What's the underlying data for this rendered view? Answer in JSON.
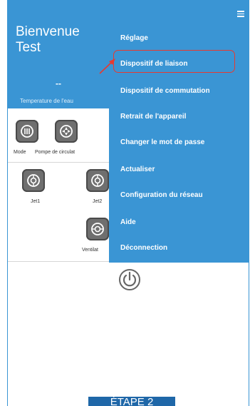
{
  "header": {
    "welcome": "Bienvenue",
    "user": "Test",
    "temperature_value": "--",
    "temperature_label": "Temperature de l'eau"
  },
  "tiles": [
    {
      "label": "Mode",
      "icon": "mode-icon"
    },
    {
      "label": "Pompe de circulat",
      "icon": "pump-icon"
    },
    {
      "label": "Jet1",
      "icon": "jet-icon"
    },
    {
      "label": "Jet2",
      "icon": "jet-icon"
    },
    {
      "label": "Ventilat",
      "icon": "fan-icon"
    }
  ],
  "menu": {
    "items": [
      "Réglage",
      "Dispositif de liaison",
      "Dispositif de commutation",
      "Retrait de l'appareil",
      "Changer le mot de passe",
      "Actualiser",
      "Configuration du réseau",
      "Aide",
      "Déconnection"
    ],
    "highlighted_index": 1
  },
  "step_label": "ÉTAPE 2",
  "colors": {
    "accent": "#3a95d4",
    "highlight": "#e8392f",
    "step_bg": "#1f67a8"
  }
}
